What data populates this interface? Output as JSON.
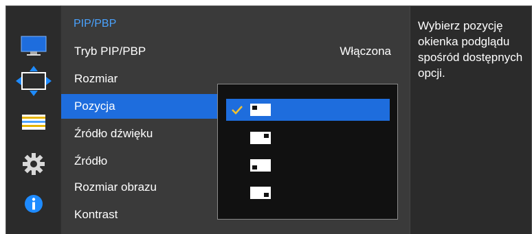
{
  "rail": {
    "items": [
      {
        "icon": "monitor-icon"
      },
      {
        "icon": "size-adjust-icon"
      },
      {
        "icon": "pip-list-icon"
      },
      {
        "icon": "gear-icon"
      },
      {
        "icon": "info-icon"
      }
    ],
    "active_index": 1
  },
  "main": {
    "title": "PIP/PBP",
    "items": [
      {
        "label": "Tryb PIP/PBP",
        "value": "Włączona"
      },
      {
        "label": "Rozmiar",
        "value": ""
      },
      {
        "label": "Pozycja",
        "value": ""
      },
      {
        "label": "Źródło dźwięku",
        "value": ""
      },
      {
        "label": "Źródło",
        "value": ""
      },
      {
        "label": "Rozmiar obrazu",
        "value": ""
      },
      {
        "label": "Kontrast",
        "value": ""
      }
    ],
    "selected_index": 2
  },
  "dropdown": {
    "options": [
      {
        "icon": "position-top-left-icon",
        "checked": true
      },
      {
        "icon": "position-top-right-icon",
        "checked": false
      },
      {
        "icon": "position-bottom-left-icon",
        "checked": false
      },
      {
        "icon": "position-bottom-right-icon",
        "checked": false
      }
    ],
    "active_index": 0
  },
  "help": {
    "text": "Wybierz pozycję okienka podglądu spośród dostępnych opcji."
  },
  "colors": {
    "accent": "#1e6ddd",
    "title_blue": "#4aa3ff",
    "check_yellow": "#f2c230"
  }
}
